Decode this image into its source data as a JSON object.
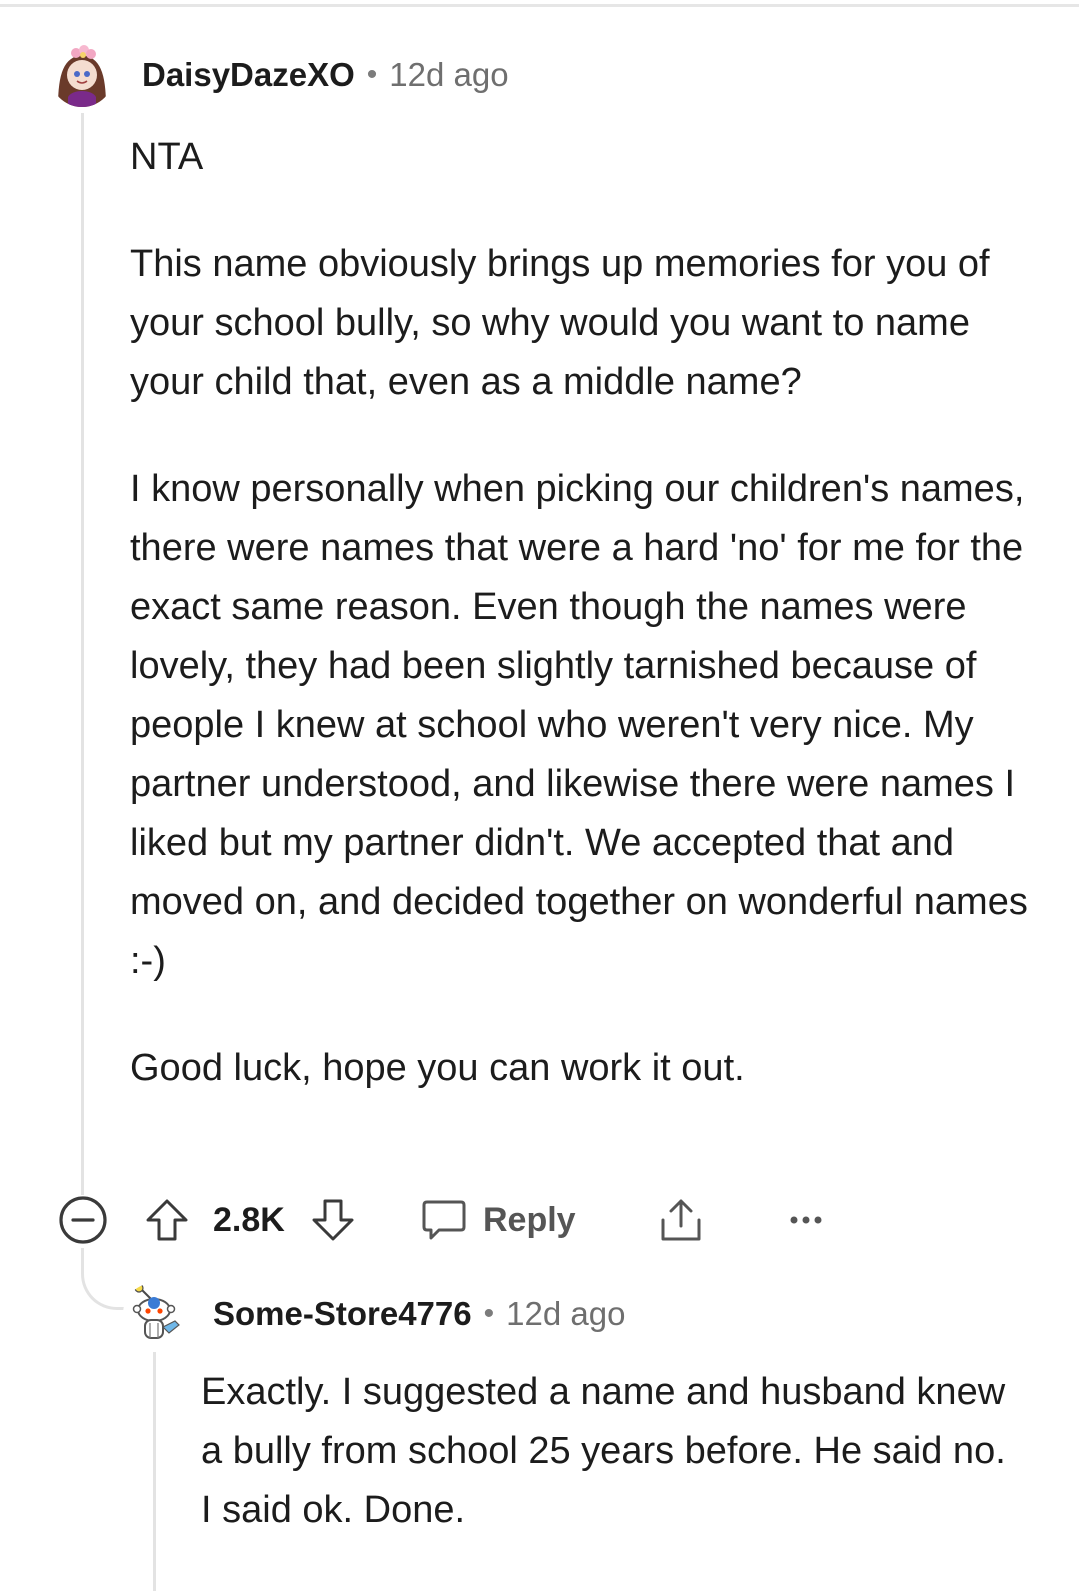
{
  "comments": [
    {
      "username": "DaisyDazeXO",
      "separator": "•",
      "timestamp": "12d ago",
      "paragraphs": [
        "NTA",
        "This name obviously brings up memories for you of your school bully, so why would you want to name your child that, even as a middle name?",
        "I know personally when picking our children's names, there were names that were a hard 'no' for me for the exact same reason. Even though the names were lovely, they had been slightly tarnished because of people I knew at school who weren't very nice. My partner understood, and likewise there were names I liked but my partner didn't. We accepted that and moved on, and decided together on wonderful names :-)",
        "Good luck, hope you can work it out."
      ],
      "actions": {
        "vote_count": "2.8K",
        "reply_label": "Reply",
        "collapse_icon": "minus-circle-icon",
        "upvote_icon": "arrow-up-outline-icon",
        "downvote_icon": "arrow-down-outline-icon",
        "reply_icon": "speech-bubble-icon",
        "share_icon": "share-upload-icon",
        "more_icon": "ellipsis-icon"
      }
    },
    {
      "username": "Some-Store4776",
      "separator": "•",
      "timestamp": "12d ago",
      "paragraphs": [
        "Exactly. I suggested a name and husband knew a bully from school 25 years before. He said no. I said ok. Done."
      ]
    }
  ],
  "colors": {
    "text": "#1c1c1c",
    "meta": "#6f6f6f",
    "thread_line": "#e3e3e3",
    "icon": "#3a3a3a",
    "reply_label": "#555555"
  }
}
